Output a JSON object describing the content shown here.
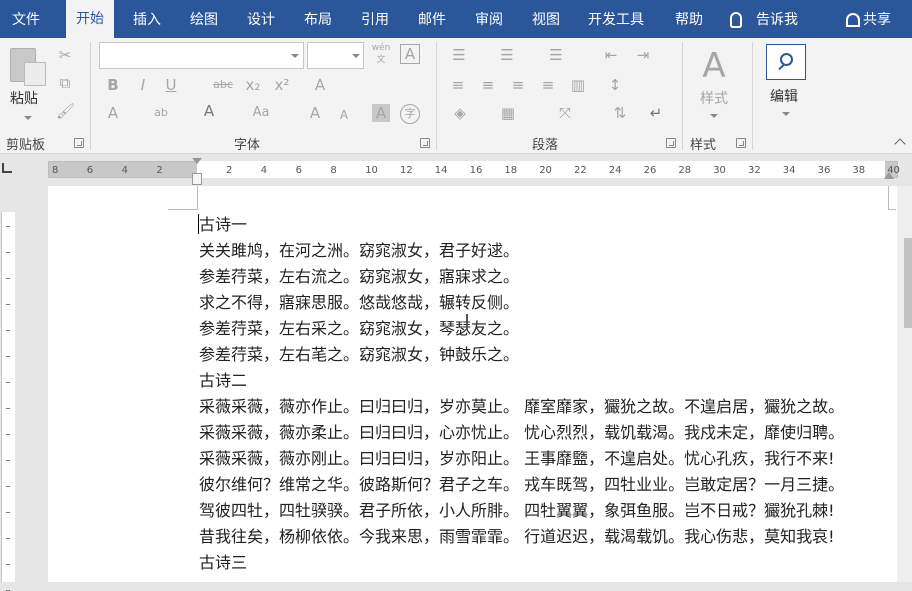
{
  "tabs": [
    {
      "label": "文件",
      "active": false
    },
    {
      "label": "开始",
      "active": true
    },
    {
      "label": "插入",
      "active": false
    },
    {
      "label": "绘图",
      "active": false
    },
    {
      "label": "设计",
      "active": false
    },
    {
      "label": "布局",
      "active": false
    },
    {
      "label": "引用",
      "active": false
    },
    {
      "label": "邮件",
      "active": false
    },
    {
      "label": "审阅",
      "active": false
    },
    {
      "label": "视图",
      "active": false
    },
    {
      "label": "开发工具",
      "active": false
    },
    {
      "label": "帮助",
      "active": false
    }
  ],
  "tell_me": "告诉我",
  "share": "共享",
  "ribbon": {
    "clipboard": {
      "paste": "粘贴",
      "label": "剪贴板"
    },
    "font": {
      "label": "字体",
      "font_name": "",
      "font_size": "",
      "wen": "wén"
    },
    "paragraph": {
      "label": "段落"
    },
    "styles": {
      "button": "样式",
      "label": "样式"
    },
    "editing": {
      "button": "编辑"
    }
  },
  "ruler_numbers": [
    "8",
    "6",
    "4",
    "2",
    "",
    "2",
    "4",
    "6",
    "8",
    "10",
    "12",
    "14",
    "16",
    "18",
    "20",
    "22",
    "24",
    "26",
    "28",
    "30",
    "32",
    "34",
    "36",
    "38",
    "40"
  ],
  "document_lines": [
    "古诗一",
    "关关雎鸠，在河之洲。窈窕淑女，君子好逑。",
    "参差荇菜，左右流之。窈窕淑女，寤寐求之。",
    "求之不得，寤寐思服。悠哉悠哉，辗转反侧。",
    "参差荇菜，左右采之。窈窕淑女，琴瑟友之。",
    "参差荇菜，左右芼之。窈窕淑女，钟鼓乐之。",
    "古诗二",
    "采薇采薇，薇亦作止。曰归曰归，岁亦莫止。 靡室靡家，玁狁之故。不遑启居，玁狁之故。",
    "采薇采薇，薇亦柔止。曰归曰归，心亦忧止。 忧心烈烈，载饥载渴。我戍未定，靡使归聘。",
    "采薇采薇，薇亦刚止。曰归曰归，岁亦阳止。 王事靡盬，不遑启处。忧心孔疚，我行不来!",
    "彼尔维何？维常之华。彼路斯何？君子之车。 戎车既驾，四牡业业。岂敢定居？一月三捷。",
    "驾彼四牡，四牡骙骙。君子所依，小人所腓。 四牡翼翼，象弭鱼服。岂不日戒？玁狁孔棘!",
    "昔我往矣，杨柳依依。今我来思，雨雪霏霏。 行道迟迟，载渴载饥。我心伤悲，莫知我哀!",
    "古诗三"
  ],
  "colors": {
    "tab_bar": "#2b579a",
    "ribbon": "#f3f3f3"
  }
}
